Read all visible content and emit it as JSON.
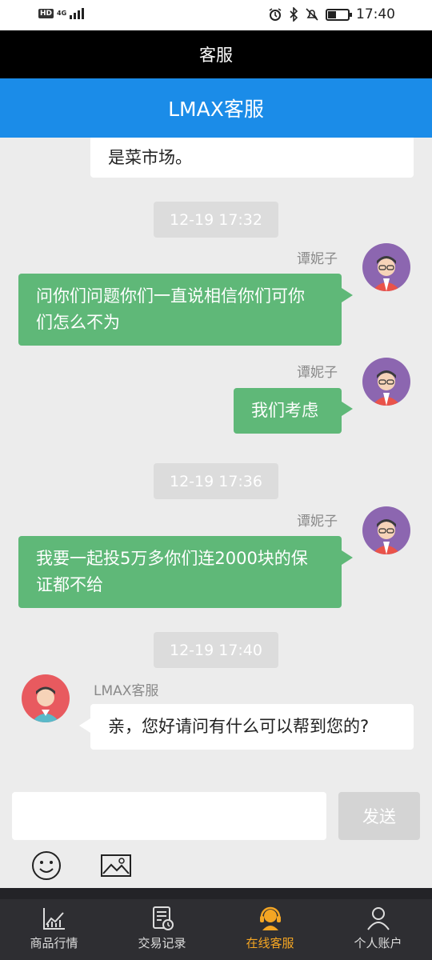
{
  "status_bar": {
    "network_badge": "HD",
    "network_type": "4G",
    "time": "17:40",
    "battery_level": 0.4
  },
  "title_bar": {
    "title": "客服"
  },
  "header": {
    "title": "LMAX客服"
  },
  "chat": {
    "partial_message": "是菜市场。",
    "timestamps": [
      "12-19 17:32",
      "12-19 17:36",
      "12-19 17:40"
    ],
    "messages": [
      {
        "sender": "谭妮子",
        "line1": "问你们问题你们一直说相信你们可你",
        "line2": "们怎么不为"
      },
      {
        "sender": "谭妮子",
        "line1": "我们考虑"
      },
      {
        "sender": "谭妮子",
        "line1": "我要一起投5万多你们连2000块的保",
        "line2": "证都不给"
      },
      {
        "sender": "LMAX客服",
        "line1": "亲，您好请问有什么可以帮到您的?"
      }
    ]
  },
  "input": {
    "message_value": "",
    "send_label": "发送"
  },
  "tabs": [
    {
      "label": "商品行情",
      "icon": "chart-icon",
      "active": false
    },
    {
      "label": "交易记录",
      "icon": "record-icon",
      "active": false
    },
    {
      "label": "在线客服",
      "icon": "headset-icon",
      "active": true
    },
    {
      "label": "个人账户",
      "icon": "person-icon",
      "active": false
    }
  ],
  "colors": {
    "header": "#1b8ce8",
    "user_bubble": "#5fb878",
    "active_tab": "#f5a623"
  }
}
